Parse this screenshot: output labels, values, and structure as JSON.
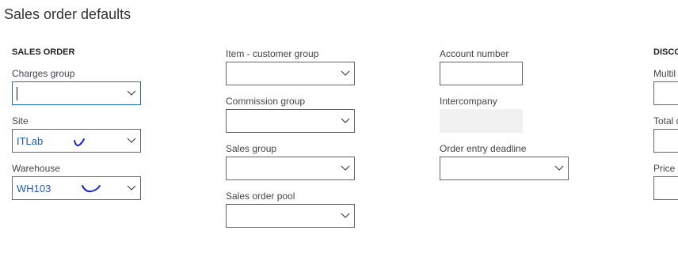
{
  "page": {
    "title": "Sales order defaults"
  },
  "col1": {
    "section": "SALES ORDER",
    "charges_group": {
      "label": "Charges group",
      "value": ""
    },
    "site": {
      "label": "Site",
      "value": "ITLab"
    },
    "warehouse": {
      "label": "Warehouse",
      "value": "WH103"
    }
  },
  "col2": {
    "item_customer_group": {
      "label": "Item - customer group"
    },
    "commission_group": {
      "label": "Commission group"
    },
    "sales_group": {
      "label": "Sales group"
    },
    "sales_order_pool": {
      "label": "Sales order pool"
    }
  },
  "col3": {
    "account_number": {
      "label": "Account number"
    },
    "intercompany": {
      "label": "Intercompany"
    },
    "order_entry_deadline": {
      "label": "Order entry deadline"
    }
  },
  "col4": {
    "section": "DISCO",
    "multiline": {
      "label": "Multil"
    },
    "total": {
      "label": "Total d"
    },
    "price": {
      "label": "Price"
    }
  },
  "icons": {
    "dropdown": "chevron-down-icon",
    "annotation": "hand-drawn-checkmark"
  },
  "colors": {
    "value_text": "#1f5fa8",
    "focus_border": "#1e6fb3",
    "ink_annotation": "#1a23d6"
  }
}
